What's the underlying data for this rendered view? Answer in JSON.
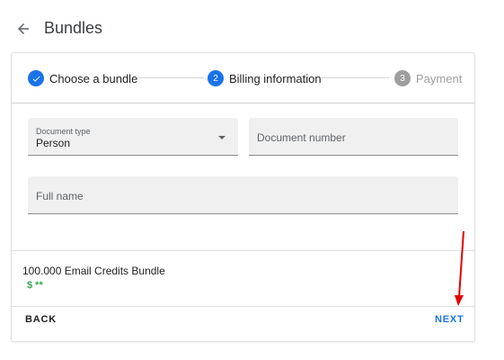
{
  "header": {
    "title": "Bundles",
    "back_icon": "arrow-left-icon"
  },
  "stepper": {
    "steps": [
      {
        "number": "✓",
        "label": "Choose a bundle",
        "state": "completed"
      },
      {
        "number": "2",
        "label": "Billing information",
        "state": "active"
      },
      {
        "number": "3",
        "label": "Payment",
        "state": "upcoming"
      }
    ]
  },
  "form": {
    "document_type": {
      "label": "Document type",
      "value": "Person"
    },
    "document_number": {
      "placeholder": "Document number"
    },
    "full_name": {
      "placeholder": "Full name"
    }
  },
  "summary": {
    "bundle_name": "100.000 Email Credits Bundle",
    "price": "$ **"
  },
  "actions": {
    "back_label": "BACK",
    "next_label": "NEXT"
  },
  "colors": {
    "primary": "#1a73e8",
    "inactive": "#9e9e9e",
    "price": "#34a853",
    "annotation": "#e60000"
  }
}
